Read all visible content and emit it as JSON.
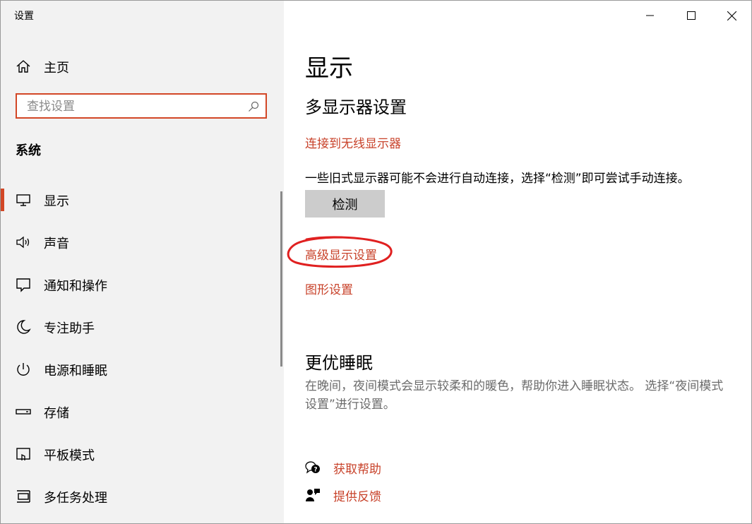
{
  "window": {
    "title": "设置",
    "controls": {
      "minimize": "minimize",
      "maximize": "maximize",
      "close": "close"
    }
  },
  "sidebar": {
    "home_label": "主页",
    "search_placeholder": "查找设置",
    "section_title": "系统",
    "items": [
      {
        "label": "显示",
        "icon": "monitor-icon",
        "active": true
      },
      {
        "label": "声音",
        "icon": "speaker-icon",
        "active": false
      },
      {
        "label": "通知和操作",
        "icon": "notification-icon",
        "active": false
      },
      {
        "label": "专注助手",
        "icon": "moon-icon",
        "active": false
      },
      {
        "label": "电源和睡眠",
        "icon": "power-icon",
        "active": false
      },
      {
        "label": "存储",
        "icon": "storage-icon",
        "active": false
      },
      {
        "label": "平板模式",
        "icon": "tablet-icon",
        "active": false
      },
      {
        "label": "多任务处理",
        "icon": "multitask-icon",
        "active": false
      }
    ]
  },
  "main": {
    "title": "显示",
    "multi_display": {
      "heading": "多显示器设置",
      "wireless_link": "连接到无线显示器",
      "legacy_text": "一些旧式显示器可能不会进行自动连接，选择“检测”即可尝试手动连接。",
      "detect_button": "检测",
      "advanced_link": "高级显示设置",
      "graphics_link": "图形设置"
    },
    "sleep": {
      "heading": "更优睡眠",
      "description": "在晚间，夜间模式会显示较柔和的暖色，帮助你进入睡眠状态。 选择“夜间模式设置”进行设置。"
    },
    "help": {
      "get_help": "获取帮助",
      "feedback": "提供反馈"
    }
  },
  "colors": {
    "accent": "#d24726",
    "link": "#c8422a",
    "sidebar_bg": "#f2f2f2",
    "annotation": "#e02020"
  }
}
